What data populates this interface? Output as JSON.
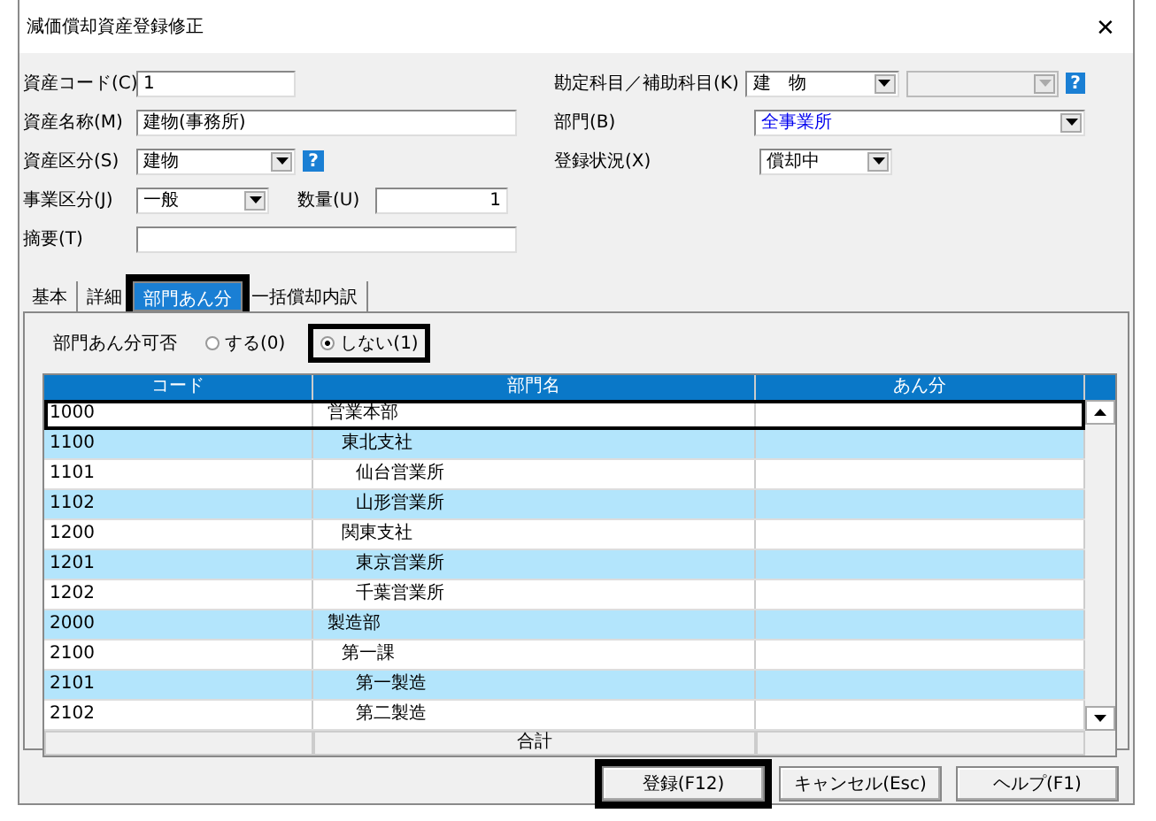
{
  "window": {
    "title": "減価償却資産登録修正",
    "close": "✕"
  },
  "form_left": [
    {
      "label": "資産コード(C)",
      "kind": "short-text",
      "value": "1"
    },
    {
      "label": "資産名称(M)",
      "kind": "long-text",
      "value": "建物(事務所)"
    },
    {
      "label": "資産区分(S)",
      "kind": "combo",
      "value": "建物",
      "help": "?"
    },
    {
      "label": "事業区分(J)",
      "kind": "combo-qty",
      "value": "一般",
      "qty_label": "数量(U)",
      "qty_value": "1"
    },
    {
      "label": "摘要(T)",
      "kind": "long-text"
    }
  ],
  "form_right": [
    {
      "label": "勘定科目／補助科目(K)",
      "kind": "combo-pair",
      "value": "建　物",
      "help": "?"
    },
    {
      "label": "部門(B)",
      "kind": "combo-wide",
      "value": "全事業所"
    },
    {
      "label": "登録状況(X)",
      "kind": "combo",
      "value": "償却中"
    }
  ],
  "tabs": [
    {
      "label": "基本",
      "selected": false,
      "highlighted": false
    },
    {
      "label": "詳細",
      "selected": false,
      "highlighted": false
    },
    {
      "label": "部門あん分",
      "selected": true,
      "highlighted": true
    },
    {
      "label": "一括償却内訳",
      "selected": false,
      "highlighted": false
    }
  ],
  "allocation": {
    "label": "部門あん分可否",
    "options": [
      {
        "label": "する(0)",
        "selected": false,
        "highlighted": false
      },
      {
        "label": "しない(1)",
        "selected": true,
        "highlighted": true
      }
    ]
  },
  "table": {
    "columns": [
      "コード",
      "部門名",
      "あん分"
    ],
    "rows": [
      {
        "code": "1000",
        "name": "営業本部",
        "selected": true,
        "children": [
          {
            "code": "1100",
            "name": "東北支社",
            "selected": false,
            "children": [
              {
                "code": "1101",
                "name": "仙台営業所",
                "selected": false
              },
              {
                "code": "1102",
                "name": "山形営業所",
                "selected": false
              }
            ]
          },
          {
            "code": "1200",
            "name": "関東支社",
            "selected": false,
            "children": [
              {
                "code": "1201",
                "name": "東京営業所",
                "selected": false
              },
              {
                "code": "1202",
                "name": "千葉営業所",
                "selected": false
              }
            ]
          }
        ]
      },
      {
        "code": "2000",
        "name": "製造部",
        "selected": false,
        "children": [
          {
            "code": "2100",
            "name": "第一課",
            "selected": false,
            "children": [
              {
                "code": "2101",
                "name": "第一製造",
                "selected": false
              },
              {
                "code": "2102",
                "name": "第二製造",
                "selected": false
              }
            ]
          }
        ]
      }
    ],
    "footer_label": "合計"
  },
  "buttons": [
    {
      "label": "登録(F12)",
      "highlighted": true
    },
    {
      "label": "キャンセル(Esc)",
      "highlighted": false
    },
    {
      "label": "ヘルプ(F1)",
      "highlighted": false
    }
  ]
}
